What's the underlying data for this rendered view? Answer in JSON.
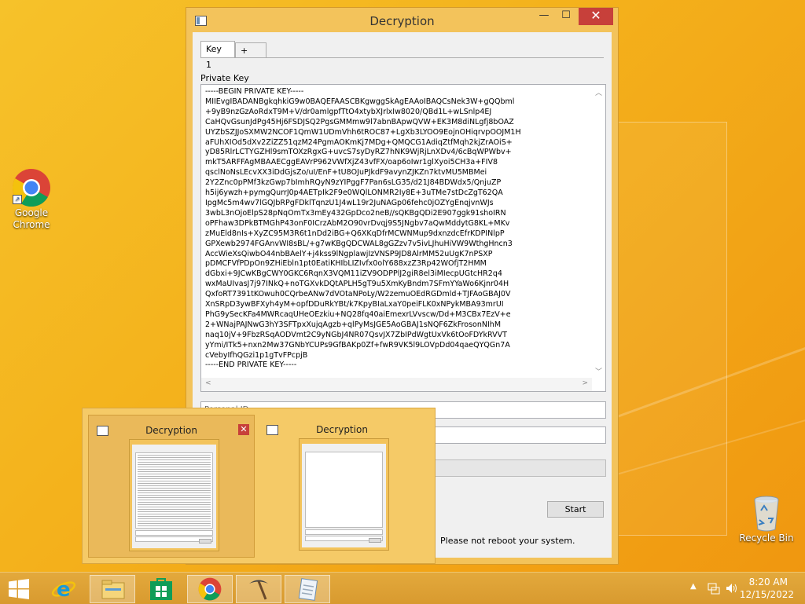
{
  "desktop": {
    "icons": [
      {
        "label_line1": "Google",
        "label_line2": "Chrome"
      },
      {
        "label_line1": "Recycle Bin"
      }
    ]
  },
  "window": {
    "title": "Decryption",
    "controls": {
      "minimize": "—",
      "maximize": "☐",
      "close": "✕"
    },
    "tabs": [
      {
        "label": "Key 1"
      },
      {
        "label": "+"
      }
    ],
    "private_key_label": "Private Key",
    "private_key_text": "-----BEGIN PRIVATE KEY-----\nMIIEvgIBADANBgkqhkiG9w0BAQEFAASCBKgwggSkAgEAAoIBAQCsNek3W+gQQbml\n+9yB9nzGzAoRdxT9M+V/dr0amlgpfTtO4xtybXJrlxIw8020/QBd1L+wLSnlp4EJ\nCaHQvGsunJdPg45Hj6FSDJSQ2PgsGMMmw9l7abnBApwQVW+EK3M8diNLgfj8bOAZ\nUYZbSZJJoSXMW2NCOF1QmW1UDmVhh6tROC87+LgXb3LYOO9EojnOHiqrvpOOJM1H\naFUhXIOd5dXv2ZiZZ51qzM24PgmAOKmKj7MDg+QMQCG1AdiqZtfMqh2kjZrAOiS+\nyD85RlrLCTYGZHl9smTOXzRgxG+uvcS7syDyRZ7hNK9WjRjLnXDv4/6cBqWPWbv+\nmkT5ARFFAgMBAAECggEAVrP962VWfXjZ43vfFX/oap6oIwr1glXyoi5CH3a+FIV8\nqsclNoNsLEcvXX3iDdGjsZo/uI/EnF+tU8OJuPJkdF9avynZJKZn7ktvMU5MBMei\n2Y2Znc0pPMf3kzGwp7bImhRQyN9zYIPggF7Pan6sLG35/d21J84BDWdx5/QnjuZP\nh5ij6ywzh+pymgQurrJ0p4AETpIk2F9e0WQlLONMR2Iy8E+3uTMe7stDcZgT62QA\nIpgMc5m4wv7lGQJbRPgFDklTqnzU1J4wL19r2JuNAGp06fehc0jOZYgEnqjvnWJs\n3wbL3nOjoElpS28pNqOmTx3mEy432GpDco2neB//sQKBgQDi2E907ggk91shoIRN\noPFhaw3DPkBTMGhP43onF0ICrzAbM2O90vrDvqj9S5JNgbv7aQwMddytG8KL+MKv\nzMuEld8nIs+XyZC95M3R6t1nDd2iBG+Q6XKqDfrMCWNMup9dxnzdcEfrKDPINlpP\nGPXewb2974FGAnvWI8sBL/+g7wKBgQDCWAL8gGZzv7v5ivLJhuHiVW9WthgHncn3\nAccWieXsQiwbO44nbBAelY+j4kss9lNgplawjIzVNSP9JD8AlrMM52uUgK7nPSXP\npDMCFVfPDpOn9ZHiEbln1pt0EatiKHIbLIZIvfx0olY688xzZ3Rp42WOfjT2HMM\ndGbxi+9JCwKBgCWY0GKC6RqnX3VQM11iZV9ODPPlJ2giR8el3iMIecpUGtcHR2q4\nwxMaUIvasJ7j97INkQ+noTGXvkDQtAPLH5gT9u5XmKyBndm7SFmYYaWo6Kjnr04H\nQxfoRT7391tKOwuh0CQrbeANw7dVOtaNPoLy/W2zemuOEdRGDmld+TJFAoGBAJ0V\nXnSRpD3ywBFXyh4yM+opfDDuRkYBt/k7KpyBIaLxaY0peiFLK0xNPykMBA93mrUI\nPhG9ySecKFa4MWRcaqUHeOEzkiu+NQ28fq40aiEmexrLVvscw/Dd+M3CBx7EzV+e\n2+WNajPAJNwG3hY3SFTpxXujqAgzb+qlPyMsJGE5AoGBAJ1sNQF6ZkFrosonNIhM\nnaq10jV+9FbzRSqAODVmt2C9yNGbJ4NR07QsvJX7ZbIPdWgtUxVk6tOoFDYkRVVT\nyYmi/ITk5+nxn2Mw37GNbYCUPs9GfBAKp0Zf+fwR9VK5l9LOVpDd04qaeQYQGn7A\ncVebyIfhQGzi1p1gTvFPcpjB\n-----END PRIVATE KEY-----",
    "personal_id_placeholder": "Personal ID",
    "second_field_value": "",
    "progress_percent": 0,
    "start_button": "Start",
    "notice": "Please not reboot your system."
  },
  "thumbnails": [
    {
      "title": "Decryption",
      "close": "✕"
    },
    {
      "title": "Decryption"
    }
  ],
  "taskbar": {
    "time": "8:20 AM",
    "date": "12/15/2022",
    "apps": [
      "start-icon",
      "internet-explorer-icon",
      "file-explorer-icon",
      "store-icon",
      "chrome-icon",
      "pickaxe-app-icon",
      "notepad-app-icon"
    ]
  },
  "colors": {
    "desktop_bg": "#f4b21c",
    "window_frame": "#f3c35b",
    "close_red": "#c7403a"
  }
}
